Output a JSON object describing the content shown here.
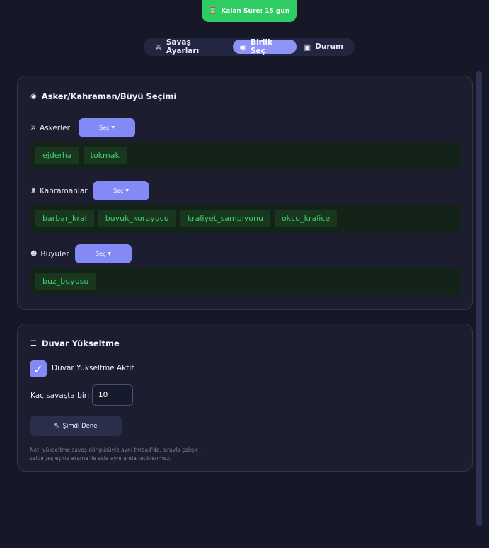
{
  "timer": {
    "icon": "hourglass-icon",
    "text": "Kalan Süre: 15 gün"
  },
  "tabs": [
    {
      "icon": "crossed-swords-icon",
      "label": "Savaş Ayarları",
      "active": false
    },
    {
      "icon": "target-icon",
      "label": "Birlik Seç",
      "active": true
    },
    {
      "icon": "ballot-box-icon",
      "label": "Durum",
      "active": false
    }
  ],
  "selection": {
    "title": "Asker/Kahraman/Büyü Seçimi",
    "select_label": "Seç",
    "groups": {
      "troops": {
        "label": "Askerler",
        "items": [
          "ejderha",
          "tokmak"
        ]
      },
      "heroes": {
        "label": "Kahramanlar",
        "items": [
          "barbar_kral",
          "buyuk_koruyucu",
          "kraliyet_sampiyonu",
          "okcu_kralice"
        ]
      },
      "spells": {
        "label": "Büyüler",
        "items": [
          "buz_buyusu"
        ]
      }
    }
  },
  "wall": {
    "title": "Duvar Yükseltme",
    "checkbox_label": "Duvar Yükseltme Aktif",
    "checked": true,
    "interval_label": "Kaç savaşta bir:",
    "interval_value": "10",
    "try_button": "Şimdi Dene",
    "note": "Not: yükseltme savaş döngüsüyle aynı thread'de, sırayla çalışır - saldırı/eşleşme arama ile asla aynı anda tetiklenmez."
  },
  "colors": {
    "accent": "#8389f5",
    "success": "#2fcc63",
    "tag_text": "#3fd06e",
    "background": "#161827"
  }
}
